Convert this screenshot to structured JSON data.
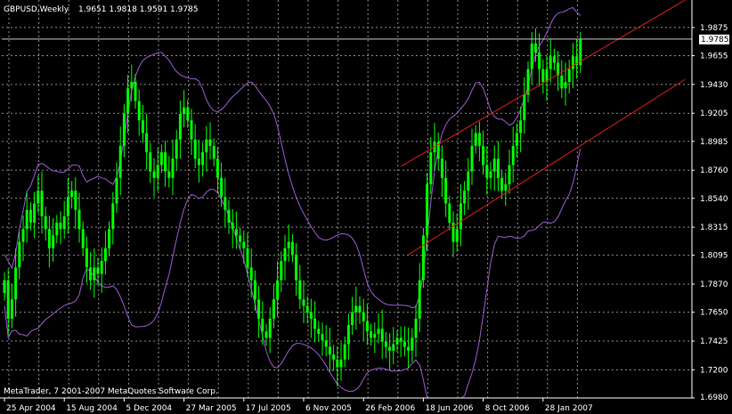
{
  "header": {
    "symbol": "GBPUSD,Weekly",
    "ohlc": "1.9651 1.9818 1.9591 1.9785"
  },
  "footer": {
    "copyright": "MetaTrader, 7 2001-2007 MetaQuotes Software Corp."
  },
  "colors": {
    "background": "#000000",
    "grid": "#8a8a8a",
    "axis": "#ffffff",
    "text": "#ffffff",
    "candles": "#00ff00",
    "bands": "#9b59d0",
    "channel": "#d91c1c",
    "current_price_line": "#c8c8c8"
  },
  "chart_data": {
    "type": "candlestick",
    "symbol": "GBPUSD",
    "timeframe": "Weekly",
    "ylim": [
      1.698,
      2.009
    ],
    "y_ticks": [
      1.9875,
      1.9655,
      1.943,
      1.9205,
      1.8985,
      1.876,
      1.854,
      1.8315,
      1.8095,
      1.787,
      1.765,
      1.7425,
      1.72,
      1.698
    ],
    "y_tick_labels": [
      "1.9875",
      "1.9655",
      "1.9430",
      "1.9205",
      "1.8985",
      "1.8760",
      "1.8540",
      "1.8315",
      "1.8095",
      "1.7870",
      "1.7650",
      "1.7425",
      "1.7200",
      "1.6980"
    ],
    "x_tick_labels": [
      "25 Apr 2004",
      "15 Aug 2004",
      "5 Dec 2004",
      "27 Mar 2005",
      "17 Jul 2005",
      "6 Nov 2005",
      "26 Feb 2006",
      "18 Jun 2006",
      "8 Oct 2006",
      "28 Jan 2007"
    ],
    "bar_count": 155,
    "bars_per_label": 16,
    "current_price": 1.9785,
    "current_price_label": "1.9785",
    "grid": true,
    "series": [
      {
        "kind": "price_close",
        "values": [
          1.79,
          1.76,
          1.775,
          1.8,
          1.82,
          1.83,
          1.845,
          1.835,
          1.85,
          1.86,
          1.84,
          1.83,
          1.815,
          1.825,
          1.835,
          1.83,
          1.84,
          1.855,
          1.86,
          1.845,
          1.83,
          1.815,
          1.8,
          1.79,
          1.8,
          1.795,
          1.805,
          1.815,
          1.83,
          1.85,
          1.87,
          1.895,
          1.92,
          1.94,
          1.945,
          1.93,
          1.915,
          1.905,
          1.89,
          1.875,
          1.87,
          1.88,
          1.89,
          1.875,
          1.87,
          1.885,
          1.9,
          1.92,
          1.925,
          1.915,
          1.9,
          1.885,
          1.88,
          1.89,
          1.9,
          1.895,
          1.885,
          1.87,
          1.855,
          1.845,
          1.835,
          1.83,
          1.825,
          1.82,
          1.815,
          1.8,
          1.79,
          1.775,
          1.76,
          1.75,
          1.745,
          1.76,
          1.775,
          1.79,
          1.805,
          1.815,
          1.82,
          1.81,
          1.79,
          1.775,
          1.77,
          1.765,
          1.76,
          1.752,
          1.748,
          1.743,
          1.738,
          1.732,
          1.728,
          1.722,
          1.728,
          1.74,
          1.755,
          1.765,
          1.77,
          1.765,
          1.758,
          1.75,
          1.745,
          1.748,
          1.752,
          1.742,
          1.738,
          1.735,
          1.74,
          1.745,
          1.742,
          1.738,
          1.735,
          1.745,
          1.76,
          1.79,
          1.825,
          1.865,
          1.89,
          1.898,
          1.885,
          1.87,
          1.85,
          1.835,
          1.82,
          1.83,
          1.85,
          1.86,
          1.875,
          1.895,
          1.905,
          1.895,
          1.88,
          1.87,
          1.875,
          1.885,
          1.87,
          1.86,
          1.865,
          1.88,
          1.895,
          1.905,
          1.915,
          1.935,
          1.955,
          1.975,
          1.968,
          1.955,
          1.945,
          1.955,
          1.965,
          1.96,
          1.95,
          1.94,
          1.945,
          1.955,
          1.965,
          1.958,
          1.978
        ]
      },
      {
        "kind": "bollinger_upper",
        "values": []
      },
      {
        "kind": "bollinger_lower",
        "values": []
      }
    ],
    "channel": {
      "upper": {
        "from": [
          106,
          1.879
        ],
        "to": [
          182,
          2.009
        ]
      },
      "lower": {
        "from": [
          108,
          1.81
        ],
        "to": [
          182,
          1.947
        ]
      }
    }
  }
}
